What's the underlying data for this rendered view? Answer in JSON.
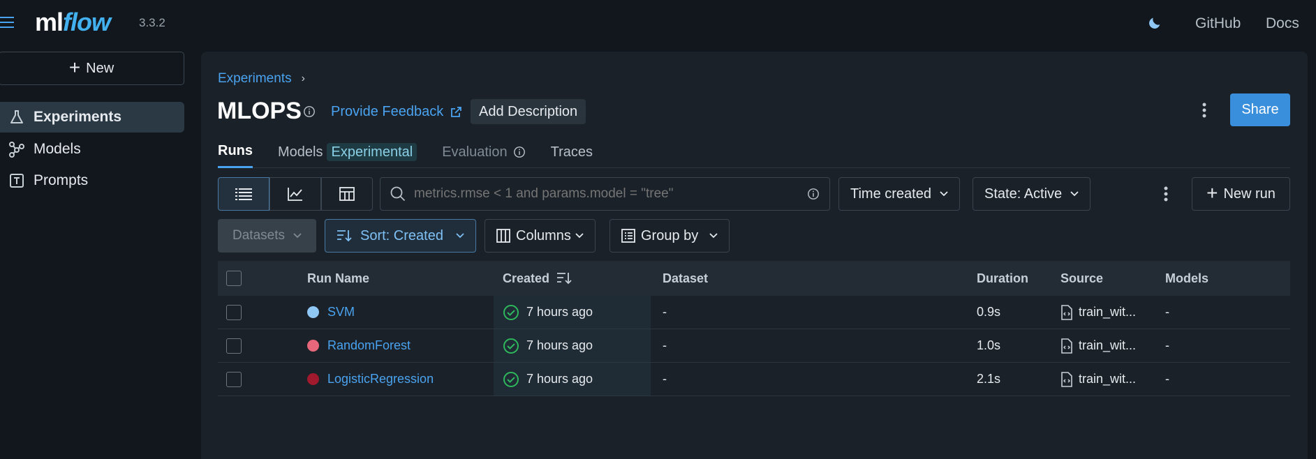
{
  "app": {
    "logo_part1": "ml",
    "logo_part2": "flow",
    "version": "3.3.2"
  },
  "topnav": {
    "github": "GitHub",
    "docs": "Docs"
  },
  "sidebar": {
    "new_label": "New",
    "items": [
      {
        "label": "Experiments",
        "icon": "flask-icon",
        "active": true
      },
      {
        "label": "Models",
        "icon": "models-icon",
        "active": false
      },
      {
        "label": "Prompts",
        "icon": "prompts-icon",
        "active": false
      }
    ]
  },
  "header": {
    "breadcrumb": "Experiments",
    "breadcrumb_sep": "›",
    "title": "MLOPS",
    "feedback": "Provide Feedback",
    "add_description": "Add Description",
    "share": "Share"
  },
  "tabs": [
    {
      "label": "Runs"
    },
    {
      "label": "Models",
      "badge": "Experimental"
    },
    {
      "label": "Evaluation"
    },
    {
      "label": "Traces"
    }
  ],
  "toolbar": {
    "search_placeholder": "metrics.rmse < 1 and params.model = \"tree\"",
    "time_created": "Time created",
    "state": "State: Active",
    "new_run": "New run",
    "datasets": "Datasets",
    "sort": "Sort: Created",
    "columns": "Columns",
    "group_by": "Group by"
  },
  "table": {
    "headers": [
      "Run Name",
      "Created",
      "Dataset",
      "Duration",
      "Source",
      "Models"
    ],
    "rows": [
      {
        "name": "SVM",
        "color": "#8fc7f5",
        "created": "7 hours ago",
        "dataset": "-",
        "duration": "0.9s",
        "source": "train_wit...",
        "models": "-"
      },
      {
        "name": "RandomForest",
        "color": "#e9677b",
        "created": "7 hours ago",
        "dataset": "-",
        "duration": "1.0s",
        "source": "train_wit...",
        "models": "-"
      },
      {
        "name": "LogisticRegression",
        "color": "#a0192c",
        "created": "7 hours ago",
        "dataset": "-",
        "duration": "2.1s",
        "source": "train_wit...",
        "models": "-"
      }
    ]
  },
  "colors": {
    "accent": "#4aa3f0",
    "share_bg": "#3a8fdc",
    "success": "#2eb85c"
  }
}
